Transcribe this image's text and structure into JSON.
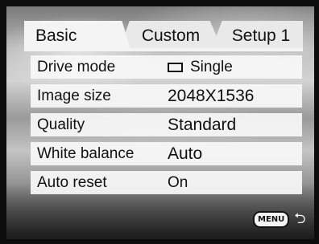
{
  "tabs": [
    {
      "label": "Basic"
    },
    {
      "label": "Custom"
    },
    {
      "label": "Setup 1"
    }
  ],
  "selected_tab": "Basic",
  "menu_rows": [
    {
      "label": "Drive mode",
      "value": "Single",
      "icon": "single-frame-icon"
    },
    {
      "label": "Image size",
      "value": "2048X1536"
    },
    {
      "label": "Quality",
      "value": "Standard"
    },
    {
      "label": "White balance",
      "value": "Auto"
    },
    {
      "label": "Auto reset",
      "value": "On"
    }
  ],
  "footer": {
    "menu_key_label": "MENU",
    "back_icon": "return-arrow-icon",
    "back_glyph": "⮌"
  }
}
